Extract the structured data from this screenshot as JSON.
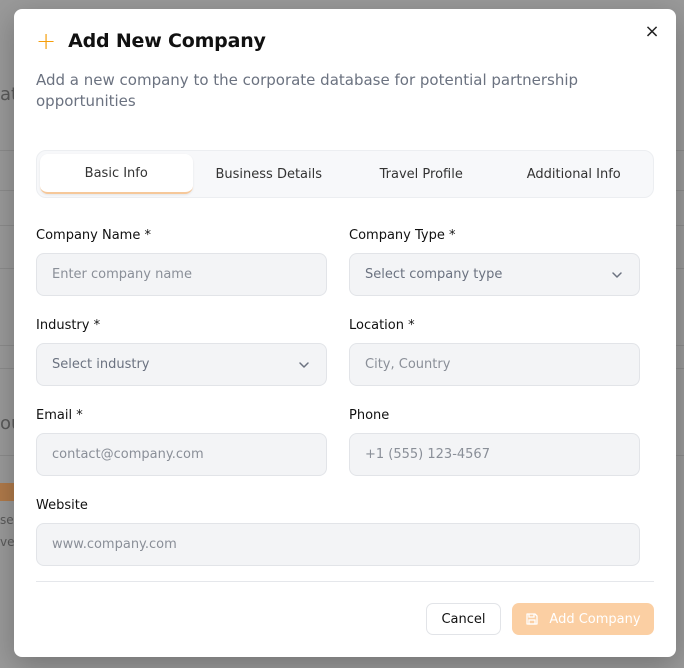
{
  "background": {
    "text_fragments": [
      "at",
      "ou",
      "ser",
      "ve"
    ]
  },
  "modal": {
    "title": "Add New Company",
    "subtitle": "Add a new company to the corporate database for potential partnership opportunities",
    "close_glyph": "×",
    "plus_glyph": "+",
    "tabs": [
      {
        "label": "Basic Info",
        "active": true
      },
      {
        "label": "Business Details",
        "active": false
      },
      {
        "label": "Travel Profile",
        "active": false
      },
      {
        "label": "Additional Info",
        "active": false
      }
    ],
    "fields": {
      "company_name": {
        "label": "Company Name *",
        "placeholder": "Enter company name",
        "value": ""
      },
      "company_type": {
        "label": "Company Type *",
        "selected": "Select company type"
      },
      "industry": {
        "label": "Industry *",
        "selected": "Select industry"
      },
      "location": {
        "label": "Location *",
        "placeholder": "City, Country",
        "value": ""
      },
      "email": {
        "label": "Email *",
        "placeholder": "contact@company.com",
        "value": ""
      },
      "phone": {
        "label": "Phone",
        "placeholder": "+1 (555) 123-4567",
        "value": ""
      },
      "website": {
        "label": "Website",
        "placeholder": "www.company.com",
        "value": ""
      }
    },
    "buttons": {
      "cancel": "Cancel",
      "add": "Add Company"
    }
  },
  "colors": {
    "accent": "#f59e0b",
    "add_button_disabled": "#fbcfa3",
    "overlay": "#9a9a9a"
  }
}
